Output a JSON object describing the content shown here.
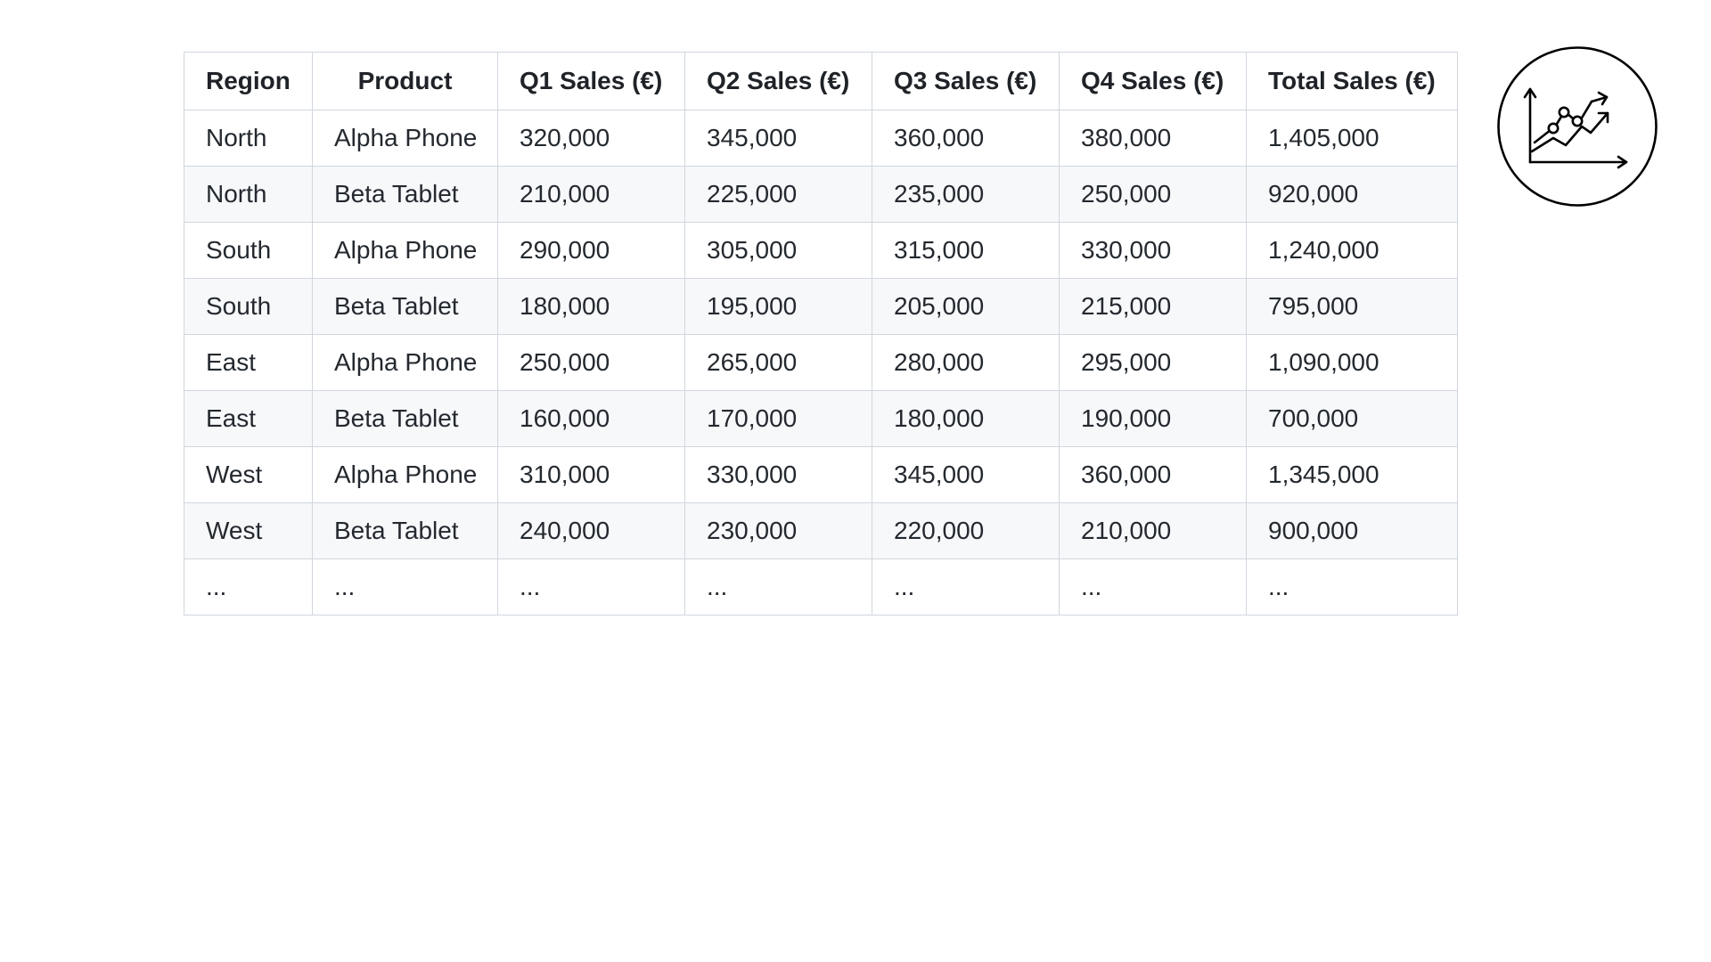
{
  "chart_data": {
    "type": "table",
    "columns": [
      "Region",
      "Product",
      "Q1 Sales (€)",
      "Q2 Sales (€)",
      "Q3 Sales (€)",
      "Q4 Sales (€)",
      "Total Sales (€)"
    ],
    "rows": [
      [
        "North",
        "Alpha Phone",
        "320,000",
        "345,000",
        "360,000",
        "380,000",
        "1,405,000"
      ],
      [
        "North",
        "Beta Tablet",
        "210,000",
        "225,000",
        "235,000",
        "250,000",
        "920,000"
      ],
      [
        "South",
        "Alpha Phone",
        "290,000",
        "305,000",
        "315,000",
        "330,000",
        "1,240,000"
      ],
      [
        "South",
        "Beta Tablet",
        "180,000",
        "195,000",
        "205,000",
        "215,000",
        "795,000"
      ],
      [
        "East",
        "Alpha Phone",
        "250,000",
        "265,000",
        "280,000",
        "295,000",
        "1,090,000"
      ],
      [
        "East",
        "Beta Tablet",
        "160,000",
        "170,000",
        "180,000",
        "190,000",
        "700,000"
      ],
      [
        "West",
        "Alpha Phone",
        "310,000",
        "330,000",
        "345,000",
        "360,000",
        "1,345,000"
      ],
      [
        "West",
        "Beta Tablet",
        "240,000",
        "230,000",
        "220,000",
        "210,000",
        "900,000"
      ],
      [
        "...",
        "...",
        "...",
        "...",
        "...",
        "...",
        "..."
      ]
    ]
  },
  "icon": {
    "name": "growth-chart-icon",
    "stroke_color": "#000000"
  },
  "colors": {
    "border": "#d0d7de",
    "stripe": "#f6f8fa",
    "text": "#24292f"
  }
}
